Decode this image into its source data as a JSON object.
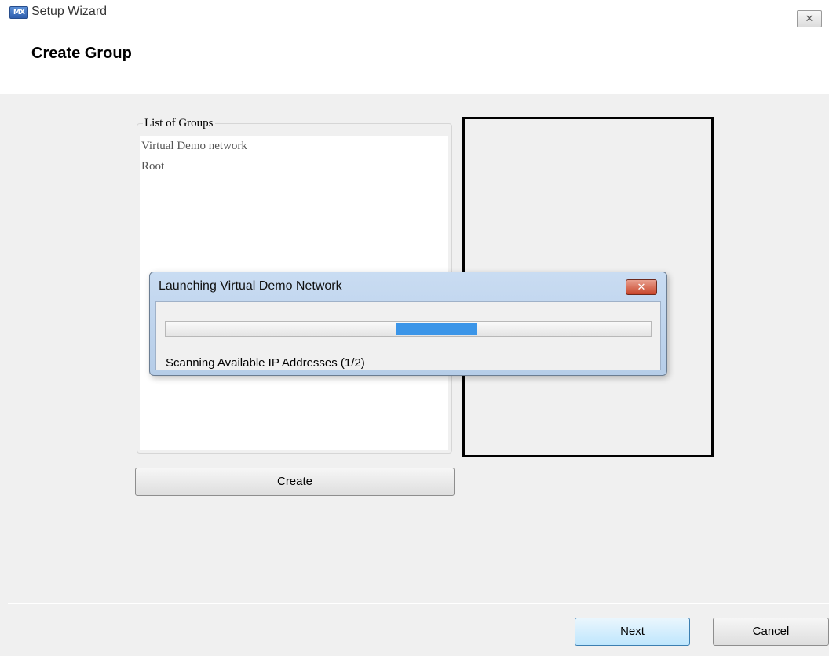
{
  "window": {
    "icon_label": "MX",
    "title": "Setup Wizard",
    "close_glyph": "✕"
  },
  "header": {
    "title": "Create Group"
  },
  "groups": {
    "legend": "List of Groups",
    "items": [
      "Virtual Demo network",
      "Root"
    ]
  },
  "create_button": "Create",
  "dialog": {
    "title": "Launching Virtual Demo Network",
    "close_glyph": "✕",
    "status": "Scanning Available IP Addresses (1/2)",
    "progress_state": "indeterminate"
  },
  "footer": {
    "next": "Next",
    "cancel": "Cancel"
  }
}
